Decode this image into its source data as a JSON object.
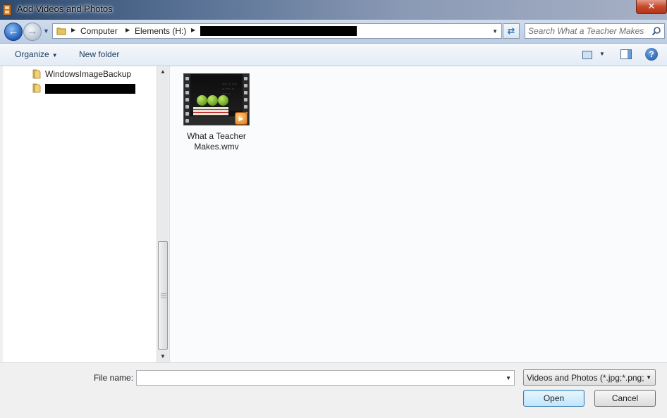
{
  "window": {
    "title": "Add Videos and Photos",
    "close_label": "✕"
  },
  "address": {
    "crumbs": [
      "Computer",
      "Elements (H:)"
    ],
    "search_placeholder": "Search What a Teacher Makes"
  },
  "toolbar": {
    "organize_label": "Organize",
    "new_folder_label": "New folder"
  },
  "tree": {
    "items": [
      {
        "label": "WindowsImageBackup"
      }
    ]
  },
  "files": [
    {
      "name": "What a Teacher Makes.wmv"
    }
  ],
  "bottom": {
    "file_name_label": "File name:",
    "file_name_value": "",
    "filter_label": "Videos and Photos (*.jpg;*.png;",
    "open_label": "Open",
    "cancel_label": "Cancel"
  },
  "colors": {
    "titlebar": "#5a7396",
    "accent": "#1f5cb7",
    "close": "#c44a2a"
  }
}
